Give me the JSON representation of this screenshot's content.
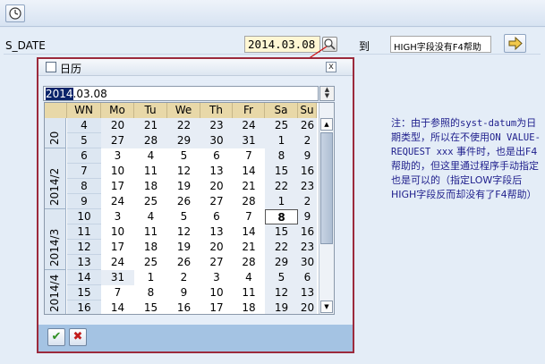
{
  "toolbar": {
    "execute_icon": "execute-clock-icon"
  },
  "selection": {
    "field_label": "S_DATE",
    "low_value": "2014.03.08",
    "to_label": "到",
    "high_value": "HIGH字段没有F4帮助",
    "f4_icon": "calendar-f4-icon",
    "multi_icon": "arrow-right-icon"
  },
  "note": {
    "line1": "注：由于参照的",
    "mono1": "syst-datum",
    "line2": "为日期类型，所以在不使用",
    "mono2": "ON VALUE-REQUEST xxx",
    "line3": "事件时，也是出F4帮助的，但这里通过程序手动指定也是可以的（指定LOW字段后HIGH字段反而却没有了F4帮助）"
  },
  "calendar": {
    "title": "日历",
    "close": "x",
    "input_selected": "2014",
    "input_rest": ".03.08",
    "headers": [
      "WN",
      "Mo",
      "Tu",
      "We",
      "Th",
      "Fr",
      "Sa",
      "Su"
    ],
    "months": [
      "20",
      "2014/2",
      "2014/3",
      "2014/4"
    ],
    "weeks": [
      {
        "wn": "4",
        "days": [
          "20",
          "21",
          "22",
          "23",
          "24",
          "25",
          "26"
        ]
      },
      {
        "wn": "5",
        "days": [
          "27",
          "28",
          "29",
          "30",
          "31",
          "1",
          "2"
        ]
      },
      {
        "wn": "6",
        "days": [
          "3",
          "4",
          "5",
          "6",
          "7",
          "8",
          "9"
        ]
      },
      {
        "wn": "7",
        "days": [
          "10",
          "11",
          "12",
          "13",
          "14",
          "15",
          "16"
        ]
      },
      {
        "wn": "8",
        "days": [
          "17",
          "18",
          "19",
          "20",
          "21",
          "22",
          "23"
        ]
      },
      {
        "wn": "9",
        "days": [
          "24",
          "25",
          "26",
          "27",
          "28",
          "1",
          "2"
        ]
      },
      {
        "wn": "10",
        "days": [
          "3",
          "4",
          "5",
          "6",
          "7",
          "8",
          "9"
        ]
      },
      {
        "wn": "11",
        "days": [
          "10",
          "11",
          "12",
          "13",
          "14",
          "15",
          "16"
        ]
      },
      {
        "wn": "12",
        "days": [
          "17",
          "18",
          "19",
          "20",
          "21",
          "22",
          "23"
        ]
      },
      {
        "wn": "13",
        "days": [
          "24",
          "25",
          "26",
          "27",
          "28",
          "29",
          "30"
        ]
      },
      {
        "wn": "14",
        "days": [
          "31",
          "1",
          "2",
          "3",
          "4",
          "5",
          "6"
        ]
      },
      {
        "wn": "15",
        "days": [
          "7",
          "8",
          "9",
          "10",
          "11",
          "12",
          "13"
        ]
      },
      {
        "wn": "16",
        "days": [
          "14",
          "15",
          "16",
          "17",
          "18",
          "19",
          "20"
        ]
      }
    ],
    "today": "8",
    "ok_icon": "checkmark-icon",
    "cancel_icon": "cancel-x-icon"
  }
}
